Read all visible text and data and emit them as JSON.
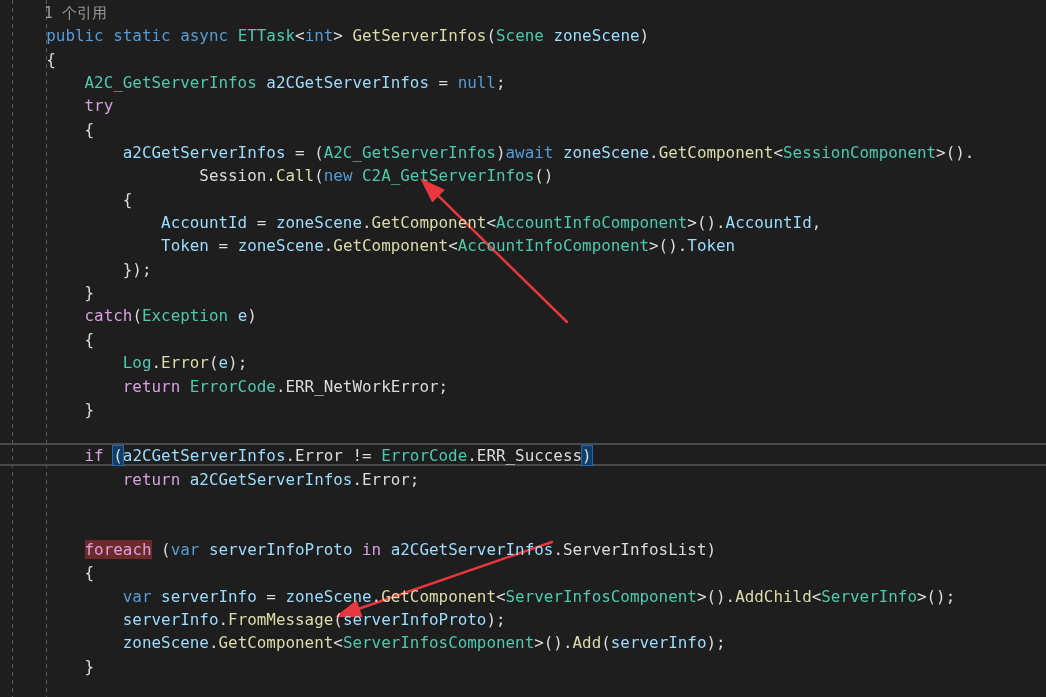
{
  "lines": [
    {
      "current": false,
      "tokens": [
        {
          "text": "    1 个引用",
          "kind": "codelens"
        }
      ]
    },
    {
      "current": false,
      "tokens": [
        {
          "text": "    public",
          "kind": "keyword"
        },
        {
          "text": " static",
          "kind": "keyword"
        },
        {
          "text": " async",
          "kind": "keyword"
        },
        {
          "text": " ETTask",
          "kind": "type"
        },
        {
          "text": "<",
          "kind": "plain"
        },
        {
          "text": "int",
          "kind": "keyword"
        },
        {
          "text": "> ",
          "kind": "plain"
        },
        {
          "text": "GetServerInfos",
          "kind": "method"
        },
        {
          "text": "(",
          "kind": "plain"
        },
        {
          "text": "Scene",
          "kind": "type"
        },
        {
          "text": " zoneScene",
          "kind": "variable"
        },
        {
          "text": ")",
          "kind": "plain"
        }
      ]
    },
    {
      "current": false,
      "tokens": [
        {
          "text": "    {",
          "kind": "plain"
        }
      ]
    },
    {
      "current": false,
      "tokens": [
        {
          "text": "        A2C_GetServerInfos",
          "kind": "type"
        },
        {
          "text": " a2CGetServerInfos",
          "kind": "variable"
        },
        {
          "text": " = ",
          "kind": "plain"
        },
        {
          "text": "null",
          "kind": "keyword"
        },
        {
          "text": ";",
          "kind": "plain"
        }
      ]
    },
    {
      "current": false,
      "tokens": [
        {
          "text": "        try",
          "kind": "control"
        }
      ]
    },
    {
      "current": false,
      "tokens": [
        {
          "text": "        {",
          "kind": "plain"
        }
      ]
    },
    {
      "current": false,
      "tokens": [
        {
          "text": "            a2CGetServerInfos",
          "kind": "variable"
        },
        {
          "text": " = (",
          "kind": "plain"
        },
        {
          "text": "A2C_GetServerInfos",
          "kind": "type"
        },
        {
          "text": ")",
          "kind": "plain"
        },
        {
          "text": "await",
          "kind": "keyword"
        },
        {
          "text": " zoneScene",
          "kind": "variable"
        },
        {
          "text": ".",
          "kind": "plain"
        },
        {
          "text": "GetComponent",
          "kind": "method"
        },
        {
          "text": "<",
          "kind": "plain"
        },
        {
          "text": "SessionComponent",
          "kind": "type"
        },
        {
          "text": ">().",
          "kind": "plain"
        }
      ]
    },
    {
      "current": false,
      "tokens": [
        {
          "text": "                    Session.",
          "kind": "plain"
        },
        {
          "text": "Call",
          "kind": "method"
        },
        {
          "text": "(",
          "kind": "plain"
        },
        {
          "text": "new",
          "kind": "keyword"
        },
        {
          "text": " C2A_GetServerInfos",
          "kind": "type"
        },
        {
          "text": "()",
          "kind": "plain"
        }
      ]
    },
    {
      "current": false,
      "tokens": [
        {
          "text": "            {",
          "kind": "plain"
        }
      ]
    },
    {
      "current": false,
      "tokens": [
        {
          "text": "                AccountId",
          "kind": "variable"
        },
        {
          "text": " = ",
          "kind": "plain"
        },
        {
          "text": "zoneScene",
          "kind": "variable"
        },
        {
          "text": ".",
          "kind": "plain"
        },
        {
          "text": "GetComponent",
          "kind": "method"
        },
        {
          "text": "<",
          "kind": "plain"
        },
        {
          "text": "AccountInfoComponent",
          "kind": "type"
        },
        {
          "text": ">().",
          "kind": "plain"
        },
        {
          "text": "AccountId",
          "kind": "variable"
        },
        {
          "text": ",",
          "kind": "plain"
        }
      ]
    },
    {
      "current": false,
      "tokens": [
        {
          "text": "                Token",
          "kind": "variable"
        },
        {
          "text": " = ",
          "kind": "plain"
        },
        {
          "text": "zoneScene",
          "kind": "variable"
        },
        {
          "text": ".",
          "kind": "plain"
        },
        {
          "text": "GetComponent",
          "kind": "method"
        },
        {
          "text": "<",
          "kind": "plain"
        },
        {
          "text": "AccountInfoComponent",
          "kind": "type"
        },
        {
          "text": ">().",
          "kind": "plain"
        },
        {
          "text": "Token",
          "kind": "variable"
        }
      ]
    },
    {
      "current": false,
      "tokens": [
        {
          "text": "            });",
          "kind": "plain"
        }
      ]
    },
    {
      "current": false,
      "tokens": [
        {
          "text": "        }",
          "kind": "plain"
        }
      ]
    },
    {
      "current": false,
      "tokens": [
        {
          "text": "        catch",
          "kind": "control"
        },
        {
          "text": "(",
          "kind": "plain"
        },
        {
          "text": "Exception",
          "kind": "type"
        },
        {
          "text": " e",
          "kind": "variable"
        },
        {
          "text": ")",
          "kind": "plain"
        }
      ]
    },
    {
      "current": false,
      "tokens": [
        {
          "text": "        {",
          "kind": "plain"
        }
      ]
    },
    {
      "current": false,
      "tokens": [
        {
          "text": "            Log",
          "kind": "type"
        },
        {
          "text": ".",
          "kind": "plain"
        },
        {
          "text": "Error",
          "kind": "method"
        },
        {
          "text": "(",
          "kind": "plain"
        },
        {
          "text": "e",
          "kind": "variable"
        },
        {
          "text": ");",
          "kind": "plain"
        }
      ]
    },
    {
      "current": false,
      "tokens": [
        {
          "text": "            return",
          "kind": "control"
        },
        {
          "text": " ErrorCode",
          "kind": "type"
        },
        {
          "text": ".ERR_NetWorkError;",
          "kind": "plain"
        }
      ]
    },
    {
      "current": false,
      "tokens": [
        {
          "text": "        }",
          "kind": "plain"
        }
      ]
    },
    {
      "current": false
    },
    {
      "current": true,
      "tokens": [
        {
          "text": "        if ",
          "kind": "control"
        },
        {
          "text": "(",
          "kind": "plain",
          "matched": true
        },
        {
          "text": "a2CGetServerInfos",
          "kind": "variable"
        },
        {
          "text": ".Error != ",
          "kind": "plain"
        },
        {
          "text": "ErrorCode",
          "kind": "type"
        },
        {
          "text": ".ERR_Success",
          "kind": "plain"
        },
        {
          "text": ")",
          "kind": "plain",
          "matched": true
        }
      ]
    },
    {
      "current": false,
      "tokens": [
        {
          "text": "            return",
          "kind": "control"
        },
        {
          "text": " a2CGetServerInfos",
          "kind": "variable"
        },
        {
          "text": ".Error;",
          "kind": "plain"
        }
      ]
    },
    {
      "current": false
    },
    {
      "current": false
    },
    {
      "current": false,
      "tokens": [
        {
          "text": "        foreach",
          "kind": "control",
          "matched": true
        },
        {
          "text": " (",
          "kind": "plain"
        },
        {
          "text": "var",
          "kind": "keyword"
        },
        {
          "text": " serverInfoProto",
          "kind": "variable"
        },
        {
          "text": " in",
          "kind": "control"
        },
        {
          "text": " a2CGetServerInfos",
          "kind": "variable"
        },
        {
          "text": ".ServerInfosList)",
          "kind": "plain"
        }
      ]
    },
    {
      "current": false,
      "tokens": [
        {
          "text": "        {",
          "kind": "plain"
        }
      ]
    },
    {
      "current": false,
      "tokens": [
        {
          "text": "            var",
          "kind": "keyword"
        },
        {
          "text": " serverInfo",
          "kind": "variable"
        },
        {
          "text": " = ",
          "kind": "plain"
        },
        {
          "text": "zoneScene",
          "kind": "variable"
        },
        {
          "text": ".",
          "kind": "plain"
        },
        {
          "text": "GetComponent",
          "kind": "method"
        },
        {
          "text": "<",
          "kind": "plain"
        },
        {
          "text": "ServerInfosComponent",
          "kind": "type"
        },
        {
          "text": ">().",
          "kind": "plain"
        },
        {
          "text": "AddChild",
          "kind": "method"
        },
        {
          "text": "<",
          "kind": "plain"
        },
        {
          "text": "ServerInfo",
          "kind": "type"
        },
        {
          "text": ">();",
          "kind": "plain"
        }
      ]
    },
    {
      "current": false,
      "tokens": [
        {
          "text": "            serverInfo",
          "kind": "variable"
        },
        {
          "text": ".",
          "kind": "plain"
        },
        {
          "text": "FromMessage",
          "kind": "method"
        },
        {
          "text": "(",
          "kind": "plain"
        },
        {
          "text": "serverInfoProto",
          "kind": "variable"
        },
        {
          "text": ");",
          "kind": "plain"
        }
      ]
    },
    {
      "current": false,
      "tokens": [
        {
          "text": "            zoneScene",
          "kind": "variable"
        },
        {
          "text": ".",
          "kind": "plain"
        },
        {
          "text": "GetComponent",
          "kind": "method"
        },
        {
          "text": "<",
          "kind": "plain"
        },
        {
          "text": "ServerInfosComponent",
          "kind": "type"
        },
        {
          "text": ">().",
          "kind": "plain"
        },
        {
          "text": "Add",
          "kind": "method"
        },
        {
          "text": "(",
          "kind": "plain"
        },
        {
          "text": "serverInfo",
          "kind": "variable"
        },
        {
          "text": ");",
          "kind": "plain"
        }
      ]
    },
    {
      "current": false,
      "tokens": [
        {
          "text": "        }",
          "kind": "plain"
        }
      ]
    }
  ]
}
